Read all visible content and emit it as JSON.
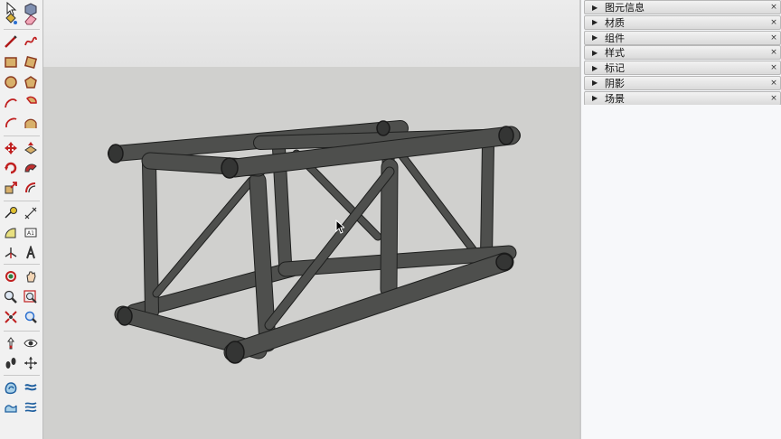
{
  "colors": {
    "truss": "#4e4f4d",
    "truss_dark": "#343534",
    "ground": "#d0d0ce",
    "sky": "#e7e7e7",
    "tray": "#f7f8fa"
  },
  "toolbar": {
    "tools": [
      "select-icon",
      "component-icon",
      "paint-bucket-icon",
      "eraser-icon",
      "line-icon",
      "freehand-icon",
      "rectangle-icon",
      "rotated-rectangle-icon",
      "circle-icon",
      "polygon-icon",
      "arc-icon",
      "pie-icon",
      "two-point-arc-icon",
      "three-point-arc-icon",
      "move-icon",
      "push-pull-icon",
      "rotate-icon",
      "follow-me-icon",
      "scale-icon",
      "offset-icon",
      "tape-measure-icon",
      "dimension-icon",
      "protractor-icon",
      "text-icon",
      "axes-icon",
      "3d-text-icon",
      "orbit-icon",
      "pan-icon",
      "zoom-icon",
      "zoom-window-icon",
      "zoom-extents-icon",
      "previous-view-icon",
      "position-camera-icon",
      "look-around-icon",
      "walk-icon",
      "section-plane-icon",
      "sandbox-contours-icon",
      "sandbox-smoove-icon",
      "sandbox-stamp-icon",
      "sandbox-drape-icon"
    ]
  },
  "tray": {
    "panels": [
      {
        "label": "图元信息"
      },
      {
        "label": "材质"
      },
      {
        "label": "组件"
      },
      {
        "label": "样式"
      },
      {
        "label": "标记"
      },
      {
        "label": "阴影"
      },
      {
        "label": "场景"
      }
    ],
    "arrow_glyph": "▶",
    "close_glyph": "×"
  }
}
